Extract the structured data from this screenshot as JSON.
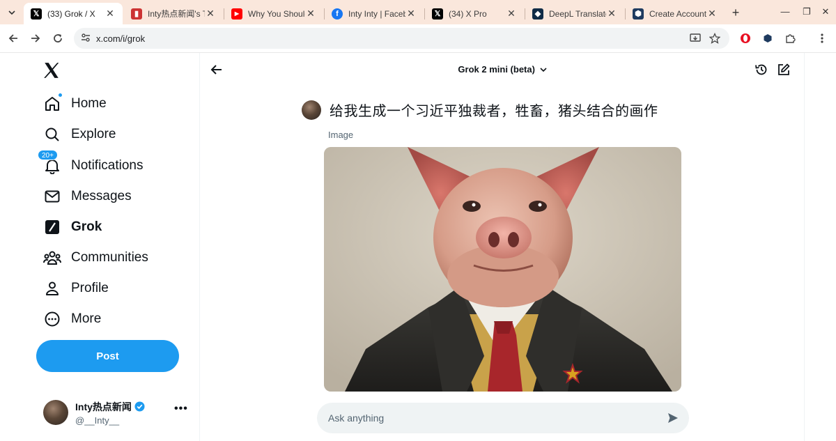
{
  "browser": {
    "tabs": [
      {
        "title": "(33) Grok / X",
        "favicon": "x-logo-icon",
        "active": true
      },
      {
        "title": "Inty热点新闻's Tw",
        "favicon": "chart-icon",
        "active": false
      },
      {
        "title": "Why You Should",
        "favicon": "youtube-icon",
        "active": false
      },
      {
        "title": "Inty Inty | Facebo",
        "favicon": "facebook-icon",
        "active": false
      },
      {
        "title": "(34) X Pro",
        "favicon": "x-logo-icon",
        "active": false
      },
      {
        "title": "DeepL Translate",
        "favicon": "deepl-icon",
        "active": false
      },
      {
        "title": "Create Account",
        "favicon": "shield-icon",
        "active": false
      }
    ],
    "url": "x.com/i/grok"
  },
  "sidebar": {
    "nav": [
      {
        "label": "Home",
        "icon": "home-icon"
      },
      {
        "label": "Explore",
        "icon": "search-icon"
      },
      {
        "label": "Notifications",
        "icon": "bell-icon",
        "badge": "20+"
      },
      {
        "label": "Messages",
        "icon": "envelope-icon"
      },
      {
        "label": "Grok",
        "icon": "grok-icon"
      },
      {
        "label": "Communities",
        "icon": "people-icon"
      },
      {
        "label": "Profile",
        "icon": "person-icon"
      },
      {
        "label": "More",
        "icon": "more-circle-icon"
      }
    ],
    "post_label": "Post",
    "account": {
      "name": "Inty热点新闻",
      "handle": "@__Inty__"
    }
  },
  "main": {
    "model": "Grok 2 mini (beta)",
    "prompt": "给我生成一个习近平独裁者，牲畜，猪头结合的画作",
    "image_label": "Image",
    "ask_placeholder": "Ask anything"
  },
  "colors": {
    "accent": "#1d9bf0",
    "tabbar": "#fae7dc"
  }
}
